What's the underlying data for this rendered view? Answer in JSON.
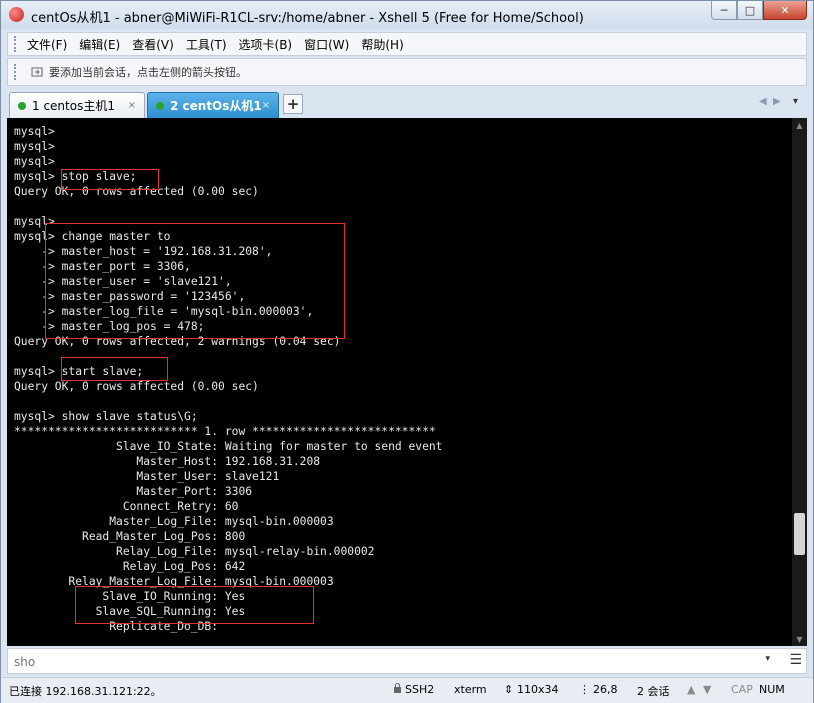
{
  "window": {
    "title": "centOs从机1 - abner@MiWiFi-R1CL-srv:/home/abner - Xshell 5 (Free for Home/School)",
    "buttons": {
      "minimize": "─",
      "maximize": "□",
      "close": "✕"
    }
  },
  "menubar": {
    "items": [
      "文件(F)",
      "编辑(E)",
      "查看(V)",
      "工具(T)",
      "选项卡(B)",
      "窗口(W)",
      "帮助(H)"
    ]
  },
  "toolbar": {
    "hint": "要添加当前会话，点击左侧的箭头按钮。"
  },
  "tabs": [
    {
      "label": "1 centos主机1",
      "close": "×",
      "active": false
    },
    {
      "label": "2 centOs从机1",
      "close": "×",
      "active": true
    }
  ],
  "tab_add": "+",
  "tab_nav": {
    "prev": "◀",
    "next": "▶",
    "menu": "▾"
  },
  "terminal": {
    "lines": [
      "mysql>",
      "mysql>",
      "mysql>",
      "mysql> stop slave;",
      "Query OK, 0 rows affected (0.00 sec)",
      "",
      "mysql>",
      "mysql> change master to",
      "    -> master_host = '192.168.31.208',",
      "    -> master_port = 3306,",
      "    -> master_user = 'slave121',",
      "    -> master_password = '123456',",
      "    -> master_log_file = 'mysql-bin.000003',",
      "    -> master_log_pos = 478;",
      "Query OK, 0 rows affected, 2 warnings (0.04 sec)",
      "",
      "mysql> start slave;",
      "Query OK, 0 rows affected (0.00 sec)",
      "",
      "mysql> show slave status\\G;",
      "*************************** 1. row ***************************",
      "               Slave_IO_State: Waiting for master to send event",
      "                  Master_Host: 192.168.31.208",
      "                  Master_User: slave121",
      "                  Master_Port: 3306",
      "                Connect_Retry: 60",
      "              Master_Log_File: mysql-bin.000003",
      "          Read_Master_Log_Pos: 800",
      "               Relay_Log_File: mysql-relay-bin.000002",
      "                Relay_Log_Pos: 642",
      "        Relay_Master_Log_File: mysql-bin.000003",
      "             Slave_IO_Running: Yes",
      "            Slave_SQL_Running: Yes",
      "              Replicate_Do_DB:"
    ],
    "highlight_color": "#e0332b"
  },
  "input_bar": {
    "value": "sho",
    "dropdown": "▾",
    "menu": "☰"
  },
  "statusbar": {
    "connection": "已连接 192.168.31.121:22。",
    "protocol": "SSH2",
    "terminal_type": "xterm",
    "size": "110x34",
    "cursor": "26,8",
    "sessions": "2 会话",
    "caps": "CAP",
    "num": "NUM"
  }
}
